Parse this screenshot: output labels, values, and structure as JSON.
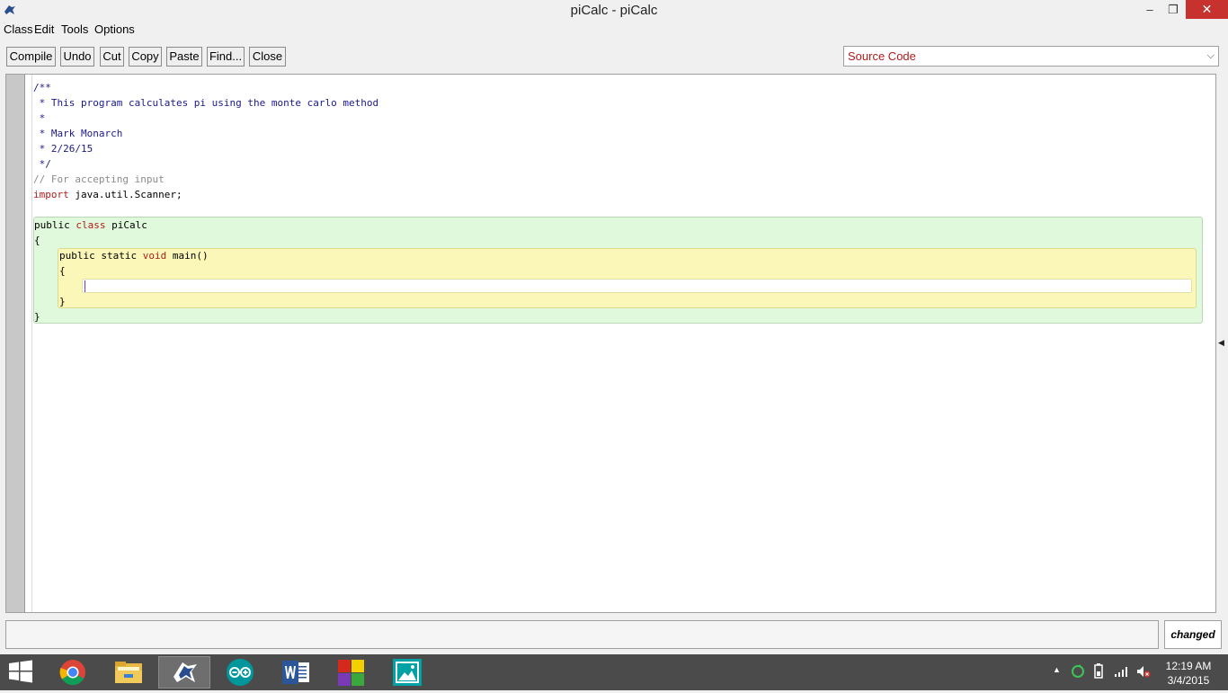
{
  "window": {
    "title": "piCalc - piCalc",
    "minimize": "–",
    "maximize": "❐",
    "close": "✕"
  },
  "menu": [
    "Class",
    "Edit",
    "Tools",
    "Options"
  ],
  "toolbar": {
    "compile": "Compile",
    "undo": "Undo",
    "cut": "Cut",
    "copy": "Copy",
    "paste": "Paste",
    "find": "Find...",
    "close": "Close"
  },
  "view_select": {
    "value": "Source Code"
  },
  "code": {
    "l1": "/**",
    "l2": " * This program calculates pi using the monte carlo method",
    "l3": " *",
    "l4": " * Mark Monarch",
    "l5": " * 2/26/15",
    "l6": " */",
    "l7": "// For accepting input",
    "l8_kw": "import",
    "l8_rest": " java.util.Scanner;",
    "l10_kw1": "public",
    "l10_kw2": "class",
    "l10_name": "piCalc",
    "l11": "{",
    "l12_kw1": "public",
    "l12_kw2": "static",
    "l12_kw3": "void",
    "l12_name": "main()",
    "l13": "{",
    "l15": "}",
    "l16": "}"
  },
  "status": {
    "message": "",
    "changed": "changed"
  },
  "taskbar": {
    "time": "12:19 AM",
    "date": "3/4/2015",
    "apps": [
      "chrome-icon",
      "file-explorer-icon",
      "bluej-icon",
      "arduino-icon",
      "word-icon",
      "app-icon",
      "photos-icon"
    ]
  }
}
